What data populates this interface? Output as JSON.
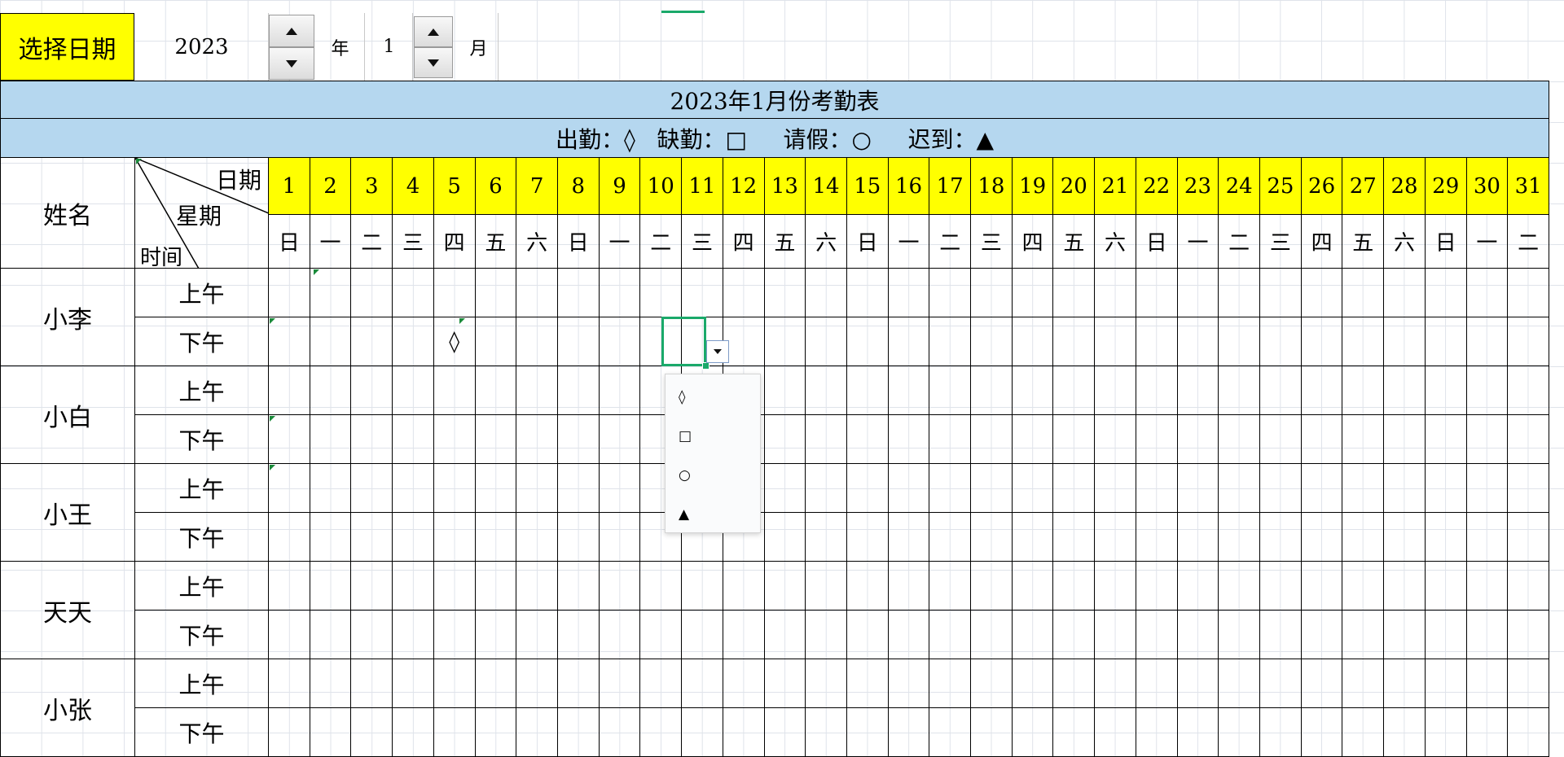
{
  "controls": {
    "select_date_label": "选择日期",
    "year_value": "2023",
    "year_unit": "年",
    "month_value": "1",
    "month_unit": "月"
  },
  "title": "2023年1月份考勤表",
  "legend": "出勤：◊   缺勤：□     请假：○     迟到：▲",
  "header": {
    "name_label": "姓名",
    "diag_date": "日期",
    "diag_weekday": "星期",
    "diag_time": "时间"
  },
  "days": [
    "1",
    "2",
    "3",
    "4",
    "5",
    "6",
    "7",
    "8",
    "9",
    "10",
    "11",
    "12",
    "13",
    "14",
    "15",
    "16",
    "17",
    "18",
    "19",
    "20",
    "21",
    "22",
    "23",
    "24",
    "25",
    "26",
    "27",
    "28",
    "29",
    "30",
    "31"
  ],
  "weekdays": [
    "日",
    "一",
    "二",
    "三",
    "四",
    "五",
    "六",
    "日",
    "一",
    "二",
    "三",
    "四",
    "五",
    "六",
    "日",
    "一",
    "二",
    "三",
    "四",
    "五",
    "六",
    "日",
    "一",
    "二",
    "三",
    "四",
    "五",
    "六",
    "日",
    "一",
    "二"
  ],
  "slots": [
    "上午",
    "下午"
  ],
  "employees": [
    {
      "name": "小李",
      "marks": {
        "pm": {
          "5": "◊"
        }
      }
    },
    {
      "name": "小白",
      "marks": {}
    },
    {
      "name": "小王",
      "marks": {}
    },
    {
      "name": "天天",
      "marks": {}
    },
    {
      "name": "小张",
      "marks": {}
    }
  ],
  "dropdown": {
    "options": [
      "◊",
      "□",
      "○",
      "▲"
    ]
  },
  "colors": {
    "title_bg": "#b5d7ef",
    "highlight_yellow": "#ffff00",
    "selection_green": "#1aa96a"
  }
}
